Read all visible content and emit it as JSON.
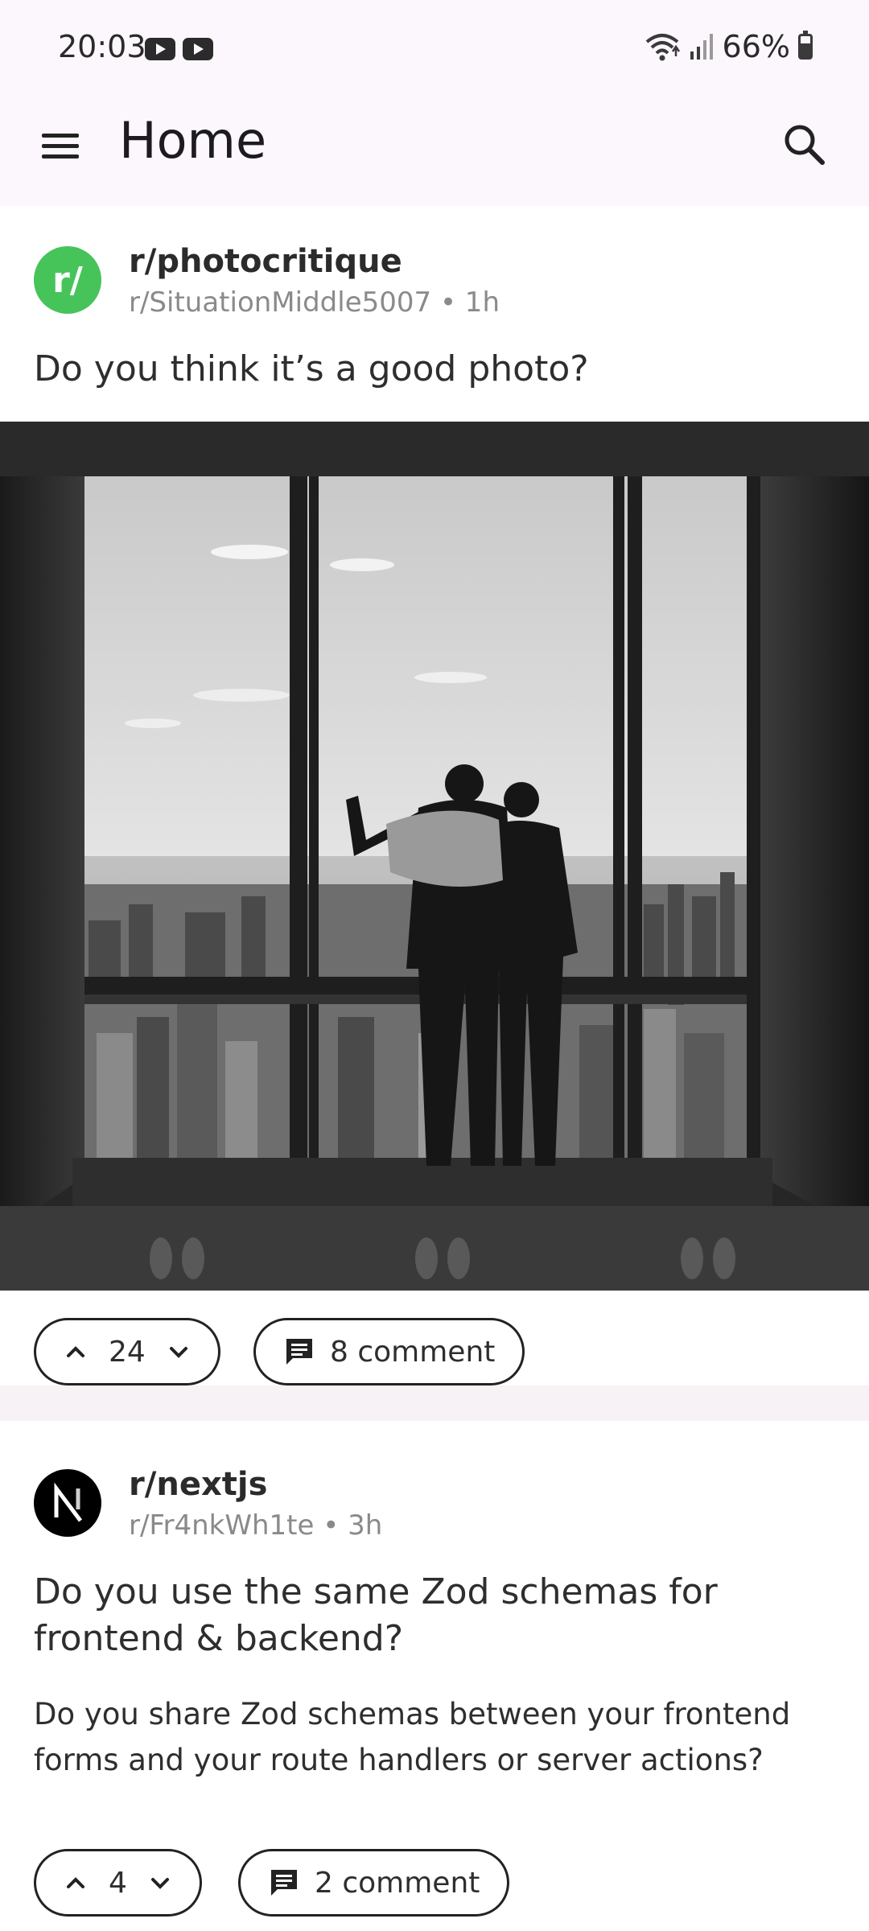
{
  "status_bar": {
    "time": "20:03",
    "battery": "66%",
    "icons": [
      "youtube-icon",
      "youtube-icon",
      "wifi-icon",
      "signal-icon",
      "battery-charging-icon"
    ]
  },
  "app_bar": {
    "title": "Home",
    "icons": [
      "menu-icon",
      "search-icon"
    ]
  },
  "posts": [
    {
      "avatar_text": "r/",
      "avatar_color": "#46c45a",
      "subreddit": "r/photocritique",
      "meta": "r/SituationMiddle5007 • 1h",
      "title": "Do you think it’s a good photo?",
      "image": "black-and-white photo of two people looking out a skyscraper window at a city",
      "votes": "24",
      "comments": "8 comment"
    },
    {
      "avatar_icon": "nextjs-logo-icon",
      "subreddit": "r/nextjs",
      "meta": "r/Fr4nkWh1te • 3h",
      "title": "Do you use the same Zod schemas for frontend & backend?",
      "body": "Do you share Zod schemas between your frontend forms and your route handlers or server actions?",
      "votes": "4",
      "comments": "2 comment"
    }
  ]
}
